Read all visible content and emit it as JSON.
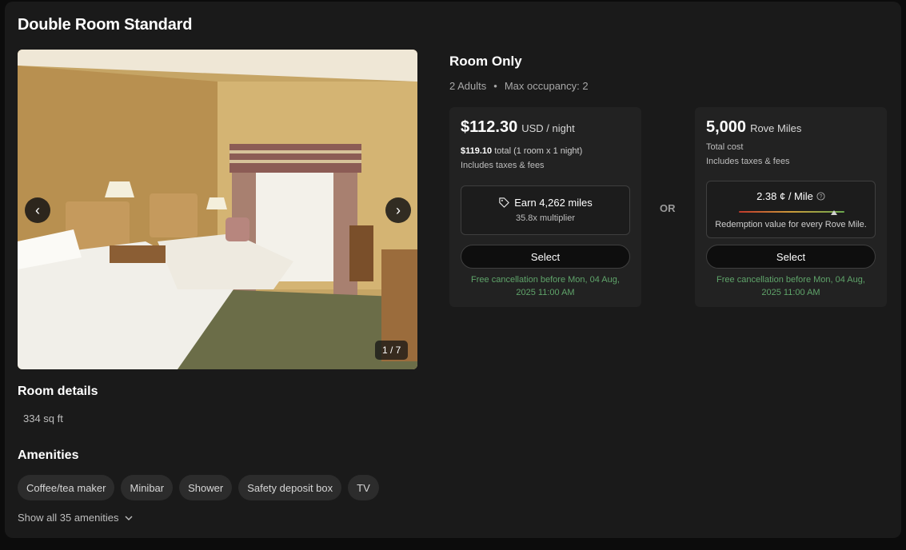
{
  "room": {
    "title": "Double Room Standard",
    "photo": {
      "counter": "1 / 7"
    },
    "details_heading": "Room details",
    "size": "334 sq ft",
    "amenities_heading": "Amenities",
    "amenities": [
      "Coffee/tea maker",
      "Minibar",
      "Shower",
      "Safety deposit box",
      "TV"
    ],
    "show_all": "Show all 35 amenities"
  },
  "rate": {
    "name": "Room Only",
    "adults": "2 Adults",
    "separator": "•",
    "max_occupancy": "Max occupancy: 2"
  },
  "cash_option": {
    "price": "$112.30",
    "unit": "USD / night",
    "total_amount": "$119.10",
    "total_text": "total (1 room x 1 night)",
    "includes": "Includes taxes & fees",
    "earn": "Earn 4,262 miles",
    "multiplier": "35.8x multiplier",
    "select_label": "Select",
    "cancellation": "Free cancellation before Mon, 04 Aug, 2025 11:00 AM"
  },
  "or_label": "OR",
  "miles_option": {
    "amount": "5,000",
    "unit": "Rove Miles",
    "total_label": "Total cost",
    "includes": "Includes taxes & fees",
    "value": "2.38 ¢ / Mile",
    "value_marker_fraction": 0.9,
    "value_caption": "Redemption value for every Rove Mile.",
    "select_label": "Select",
    "cancellation": "Free cancellation before Mon, 04 Aug, 2025 11:00 AM"
  },
  "colors": {
    "background": "#1a1a1a",
    "box": "#222222",
    "cancellation_green": "#5fa46a"
  }
}
